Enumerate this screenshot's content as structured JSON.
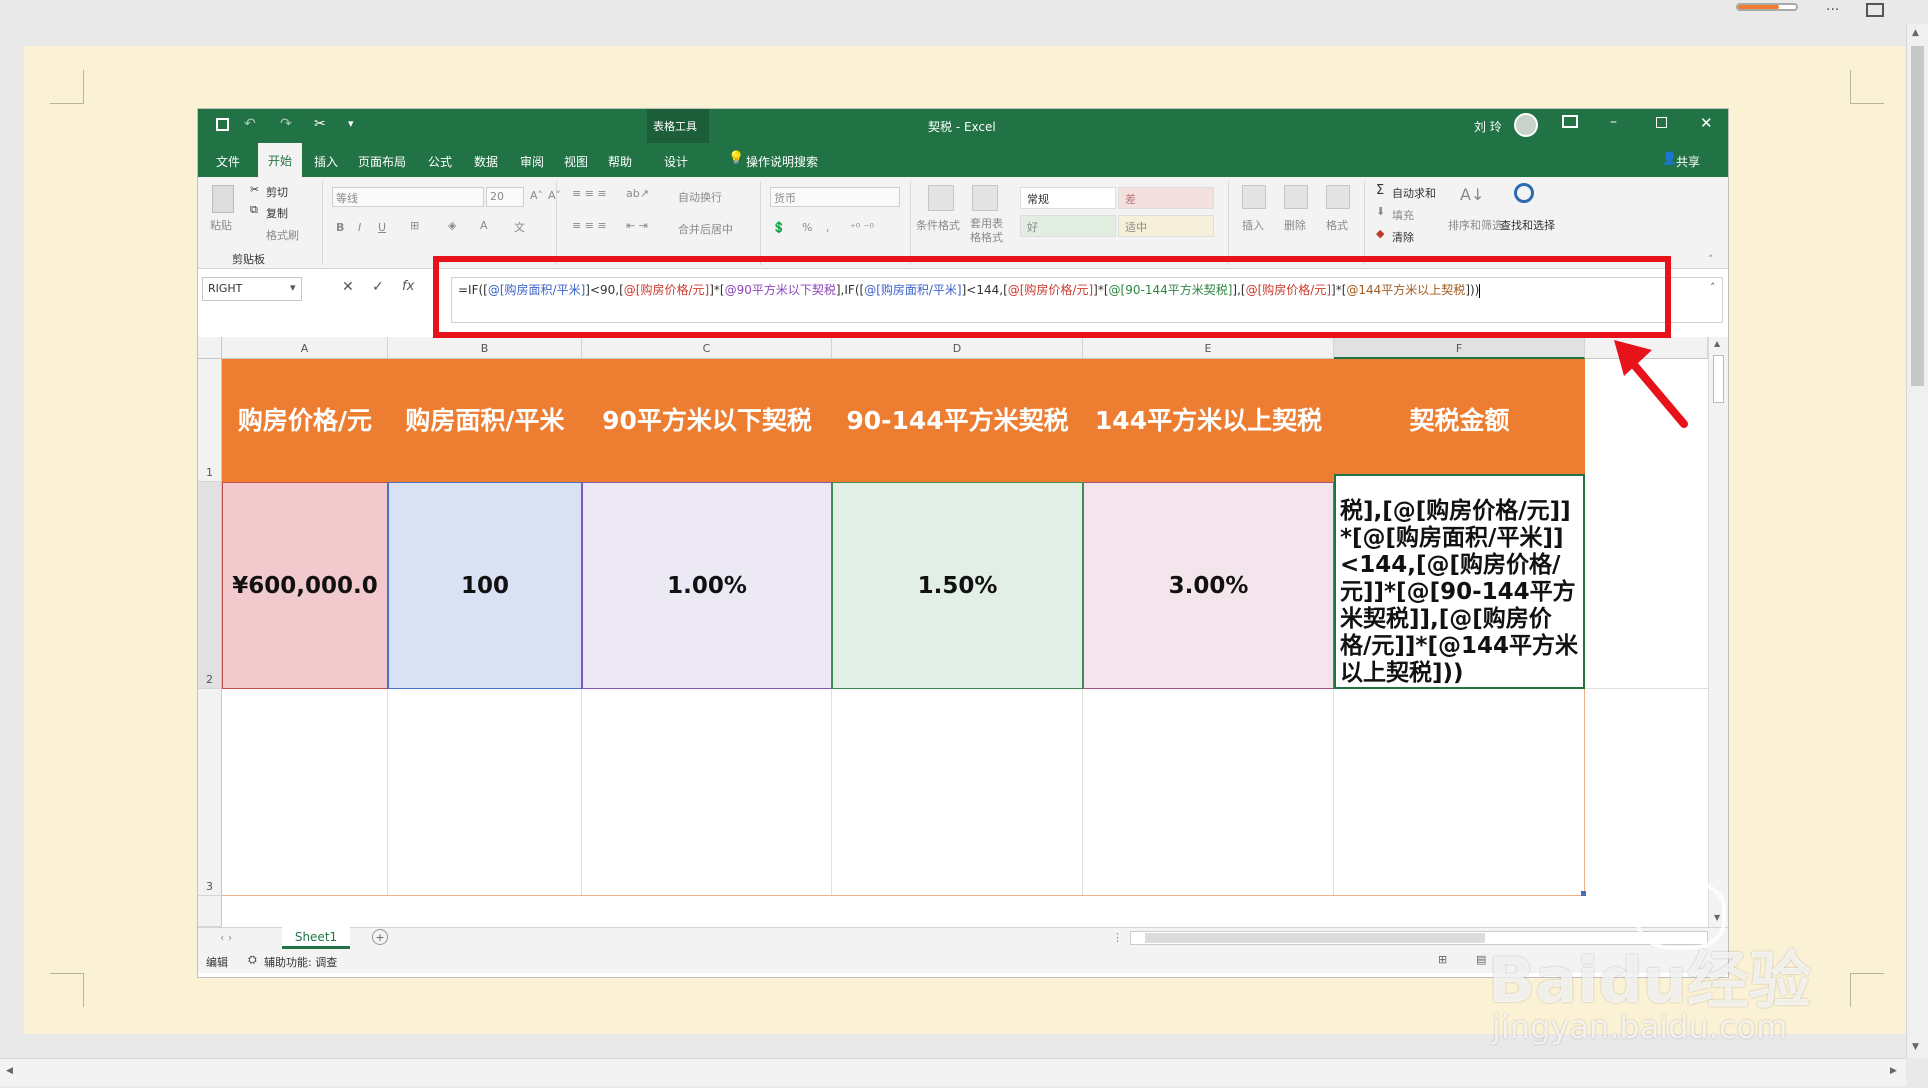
{
  "window": {
    "title": "契税 - Excel",
    "context_tab": "表格工具",
    "user": "刘 玲",
    "minimize_icon": "minimize-icon",
    "restore_icon": "restore-icon",
    "close_icon": "close-icon"
  },
  "tabs": [
    "文件",
    "开始",
    "插入",
    "页面布局",
    "公式",
    "数据",
    "审阅",
    "视图",
    "帮助",
    "设计"
  ],
  "active_tab": "开始",
  "tell_me": "操作说明搜索",
  "share": "共享",
  "ribbon": {
    "clipboard": {
      "paste": "粘贴",
      "cut": "剪切",
      "copy": "复制",
      "format_painter": "格式刷",
      "group": "剪贴板"
    },
    "font": {
      "name": "等线",
      "size": "20",
      "bold": "B",
      "italic": "I",
      "underline": "U"
    },
    "alignment": {
      "wrap": "自动换行",
      "merge": "合并后居中"
    },
    "number": {
      "format": "货币",
      "percent": "%",
      "comma": ","
    },
    "styles": {
      "conditional": "条件格式",
      "table_format": "套用表格格式",
      "normal": "常规",
      "bad": "差",
      "good": "好",
      "neutral": "适中"
    },
    "cells": {
      "insert": "插入",
      "delete": "删除",
      "format": "格式"
    },
    "editing": {
      "autosum": "自动求和",
      "fill": "填充",
      "clear": "清除",
      "sort": "排序和筛选",
      "find": "查找和选择"
    }
  },
  "name_box": "RIGHT",
  "fx": "fx",
  "formula_parts": [
    {
      "t": "=IF([",
      "c": "f-dark"
    },
    {
      "t": "@[购房面积/平米]",
      "c": "f-blue"
    },
    {
      "t": "]<90,[",
      "c": "f-dark"
    },
    {
      "t": "@[购房价格/元]",
      "c": "f-red"
    },
    {
      "t": "]*[",
      "c": "f-dark"
    },
    {
      "t": "@90平方米以下契税",
      "c": "f-purple"
    },
    {
      "t": "],IF([",
      "c": "f-dark"
    },
    {
      "t": "@[购房面积/平米]",
      "c": "f-blue"
    },
    {
      "t": "]<144,[",
      "c": "f-dark"
    },
    {
      "t": "@[购房价格/元]",
      "c": "f-red"
    },
    {
      "t": "]*[",
      "c": "f-dark"
    },
    {
      "t": "@[90-144平方米契税]",
      "c": "f-green"
    },
    {
      "t": "],[",
      "c": "f-dark"
    },
    {
      "t": "@[购房价格/元]",
      "c": "f-red"
    },
    {
      "t": "]*[",
      "c": "f-dark"
    },
    {
      "t": "@144平方米以上契税",
      "c": "f-brown"
    },
    {
      "t": "]))",
      "c": "f-dark"
    }
  ],
  "columns": [
    "A",
    "B",
    "C",
    "D",
    "E",
    "F"
  ],
  "rows": [
    "1",
    "2",
    "3"
  ],
  "headers": [
    "购房价格/元",
    "购房面积/平米",
    "90平方米以下契税",
    "90-144平方米契税",
    "144平方米以上契税",
    "契税金额"
  ],
  "data_row": [
    "¥600,000.0",
    "100",
    "1.00%",
    "1.50%",
    "3.00%"
  ],
  "editing_cell_text": "税],[@[购房价格/元]]*[@[购房面积/平米]]<144,[@[购房价格/元]]*[@[90-144平方米契税]],[@[购房价格/元]]*[@144平方米以上契税]))",
  "sheet_tab": "Sheet1",
  "status": {
    "mode": "编辑",
    "accessibility": "辅助功能: 调查"
  },
  "watermark": {
    "brand": "Baidu经验",
    "url": "jingyan.baidu.com"
  },
  "colors": {
    "excel_green": "#217346",
    "header_orange": "#ed7d31",
    "highlight_red": "#e8131a"
  }
}
